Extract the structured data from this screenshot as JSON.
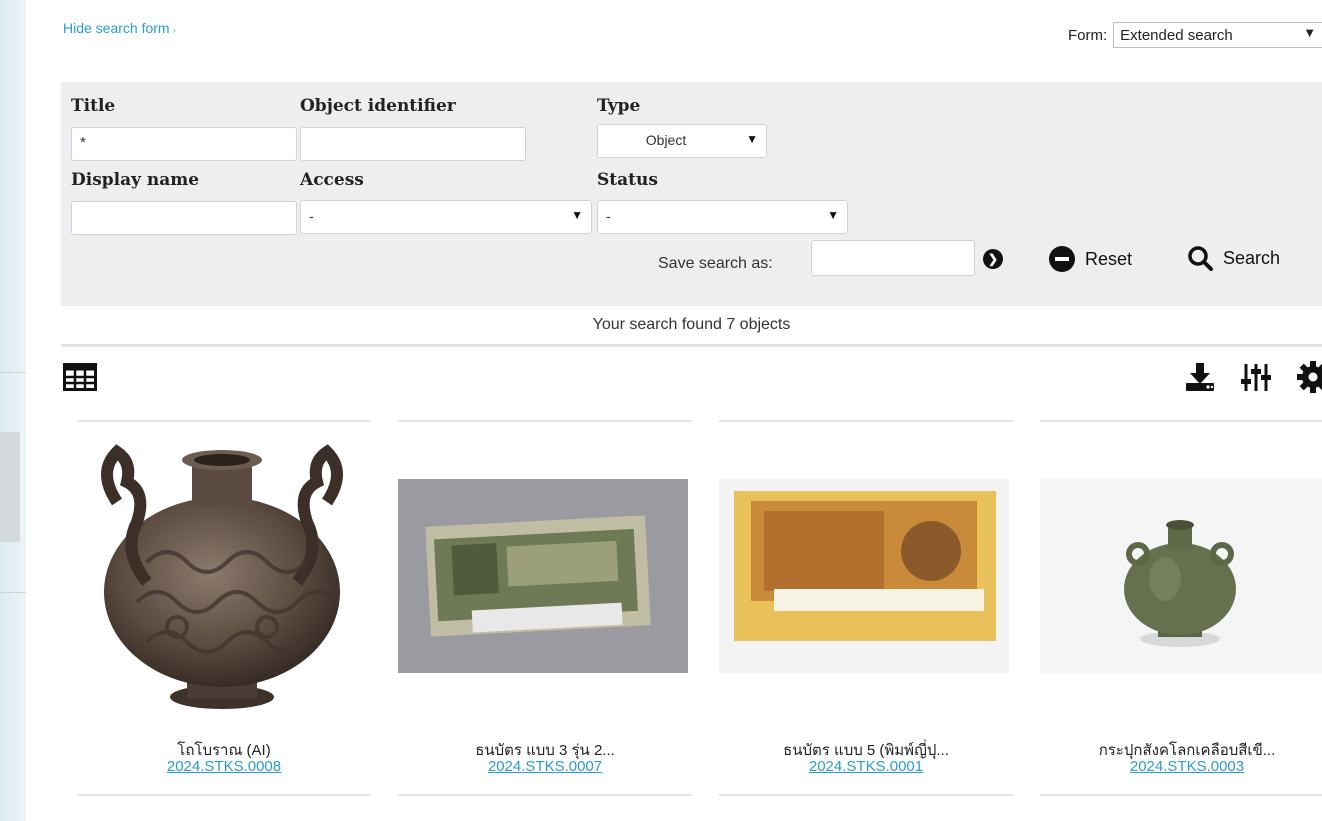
{
  "search_toggle": {
    "label": "Hide search form",
    "chevron": "›"
  },
  "form_selector": {
    "label": "Form:",
    "value": "Extended search"
  },
  "fields": {
    "title": {
      "label": "Title",
      "value": "*"
    },
    "object_identifier": {
      "label": "Object identifier",
      "value": ""
    },
    "type": {
      "label": "Type",
      "value": "Object"
    },
    "display_name": {
      "label": "Display name",
      "value": ""
    },
    "access": {
      "label": "Access",
      "value": "-"
    },
    "status": {
      "label": "Status",
      "value": "-"
    }
  },
  "save_search": {
    "label": "Save search as:",
    "value": ""
  },
  "buttons": {
    "reset": "Reset",
    "search": "Search"
  },
  "results": {
    "summary": "Your search found 7 objects"
  },
  "toolbar_icons": [
    "table-view-icon",
    "download-icon",
    "sliders-icon",
    "gear-icon"
  ],
  "items": [
    {
      "title": "โถโบราณ (AI)",
      "identifier": "2024.STKS.0008",
      "image": "dragon-vase"
    },
    {
      "title": "ธนบัตร แบบ 3 รุ่น 2...",
      "identifier": "2024.STKS.0007",
      "image": "banknote-green"
    },
    {
      "title": "ธนบัตร แบบ 5 (พิมพ์ญี่ปุ...",
      "identifier": "2024.STKS.0001",
      "image": "banknote-orange"
    },
    {
      "title": "กระปุกสังคโลกเคลือบสีเขี...",
      "identifier": "2024.STKS.0003",
      "image": "celadon-jar"
    }
  ],
  "colors": {
    "link": "#2a9bd3",
    "panel": "#eceeef"
  }
}
